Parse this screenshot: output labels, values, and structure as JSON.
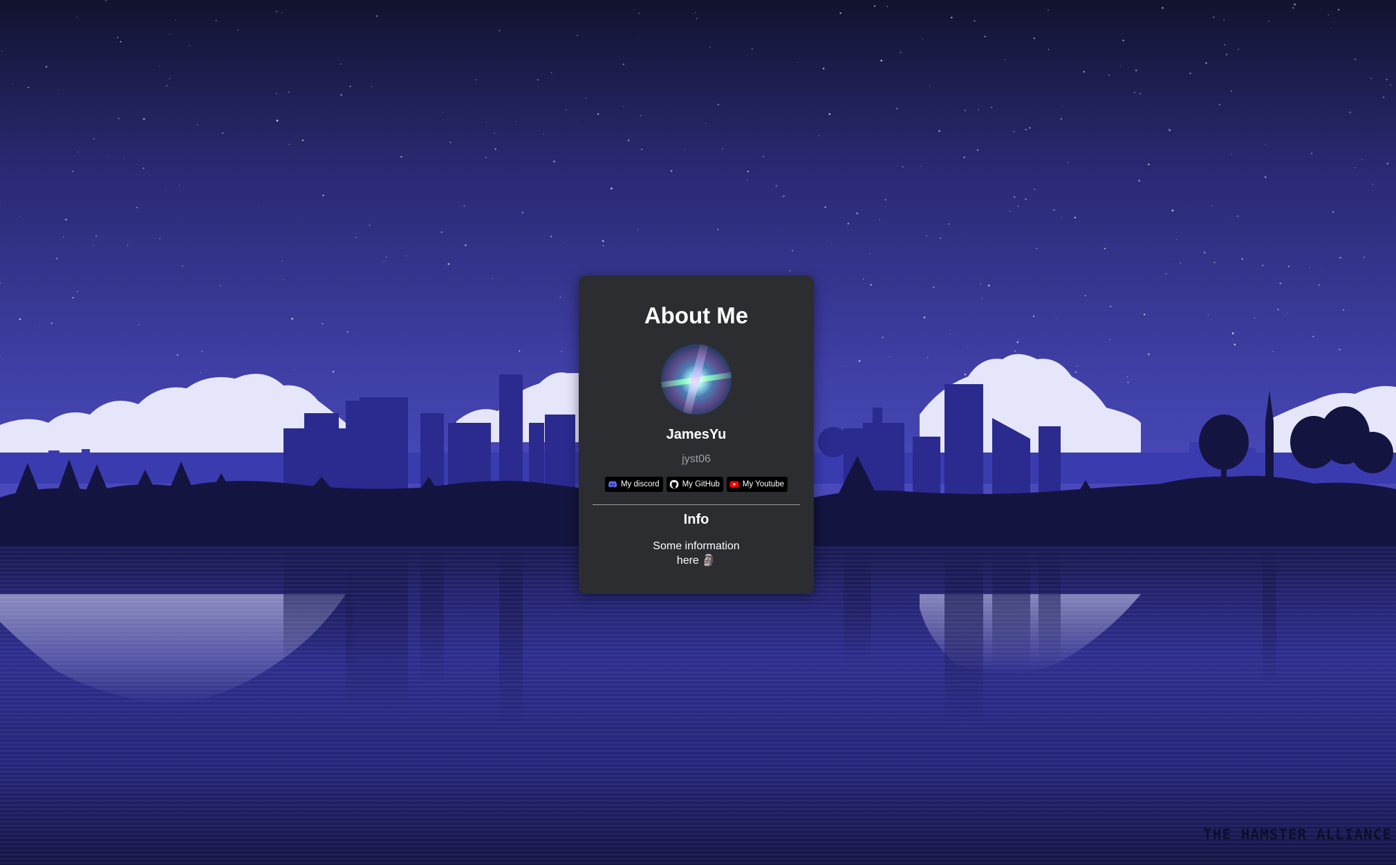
{
  "card": {
    "title": "About Me",
    "username": "JamesYu",
    "handle": "jyst06",
    "links": [
      {
        "label": "My discord",
        "icon": "discord-icon",
        "color": "#5865f2"
      },
      {
        "label": "My GitHub",
        "icon": "github-icon",
        "color": "#ffffff"
      },
      {
        "label": "My Youtube",
        "icon": "youtube-icon",
        "color": "#ff0000"
      }
    ],
    "info_title": "Info",
    "info_text": "Some information here 🗿"
  },
  "background": {
    "watermark": "THE HAMSTER ALLIANCE",
    "colors": {
      "sky_top": "#12132f",
      "sky_bottom": "#4848b8",
      "clouds": "#e6e6fb",
      "skyline": "#2a2a8a",
      "land": "#141440",
      "water": "#2c2c8a"
    }
  },
  "colors": {
    "card_background": "#2b2d31",
    "handle_text": "#9aa0a6",
    "badge_background": "#000000"
  }
}
